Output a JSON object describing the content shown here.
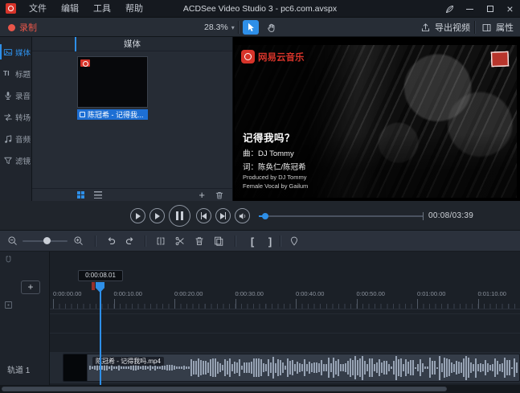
{
  "colors": {
    "accent": "#2e8fe8",
    "selection_blue": "#1d6fd4",
    "record_red": "#e8564a",
    "brand_red": "#d7342a"
  },
  "titlebar": {
    "app_title": "ACDSee Video Studio 3 - pc6.com.avspx",
    "menus": [
      "文件",
      "编辑",
      "工具",
      "帮助"
    ]
  },
  "toolbar": {
    "record_label": "录制",
    "zoom_value": "28.3%",
    "export_label": "导出视频",
    "properties_label": "属性"
  },
  "sidebar": {
    "items": [
      {
        "label": "媒体",
        "icon": "media-icon",
        "active": true
      },
      {
        "label": "标题",
        "icon": "title-icon",
        "active": false
      },
      {
        "label": "录音",
        "icon": "microphone-icon",
        "active": false
      },
      {
        "label": "转场",
        "icon": "transition-icon",
        "active": false
      },
      {
        "label": "音频",
        "icon": "audio-icon",
        "active": false
      },
      {
        "label": "滤镜",
        "icon": "filter-icon",
        "active": false
      }
    ]
  },
  "media_panel": {
    "header": "媒体",
    "selected_item": "陈冠希 - 记得我..."
  },
  "preview": {
    "brand": "网易云音乐",
    "song_title": "记得我吗？",
    "credit_music": "曲：DJ Tommy",
    "credit_lyrics": "词：陈奂仁/陈冠希",
    "credit_produced": "Produced by DJ Tommy",
    "credit_vocal": "Female Vocal by Gailum"
  },
  "transport": {
    "time_display": "00:08/03:39"
  },
  "timeline": {
    "playhead_time": "0:00:08.01",
    "ruler_ticks": [
      "0:00:00.00",
      "0:00:10.00",
      "0:00:20.00",
      "0:00:30.00",
      "0:00:40.00",
      "0:00:50.00",
      "0:01:00.00",
      "0:01:10.00"
    ],
    "track_name": "轨道 1",
    "clip_name": "陈冠希 - 记得我吗.mp4"
  }
}
